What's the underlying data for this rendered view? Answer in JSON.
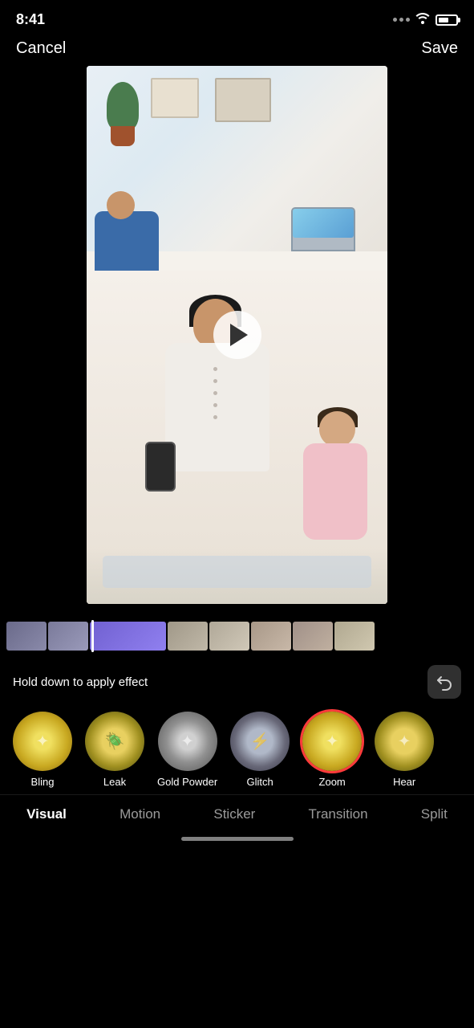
{
  "statusBar": {
    "time": "8:41"
  },
  "header": {
    "cancelLabel": "Cancel",
    "saveLabel": "Save"
  },
  "controls": {
    "holdText": "Hold down to apply effect"
  },
  "effects": [
    {
      "id": "bling",
      "label": "Bling",
      "style": "bling",
      "selected": false
    },
    {
      "id": "leak",
      "label": "Leak",
      "style": "leak",
      "selected": false
    },
    {
      "id": "gold-powder",
      "label": "Gold Powder",
      "style": "gold",
      "selected": false
    },
    {
      "id": "glitch",
      "label": "Glitch",
      "style": "glitch",
      "selected": false
    },
    {
      "id": "zoom",
      "label": "Zoom",
      "style": "zoom",
      "selected": true
    },
    {
      "id": "heart",
      "label": "Hear",
      "style": "heart",
      "selected": false
    }
  ],
  "tabs": [
    {
      "id": "visual",
      "label": "Visual",
      "active": true
    },
    {
      "id": "motion",
      "label": "Motion",
      "active": false
    },
    {
      "id": "sticker",
      "label": "Sticker",
      "active": false
    },
    {
      "id": "transition",
      "label": "Transition",
      "active": false
    },
    {
      "id": "split",
      "label": "Split",
      "active": false
    }
  ]
}
